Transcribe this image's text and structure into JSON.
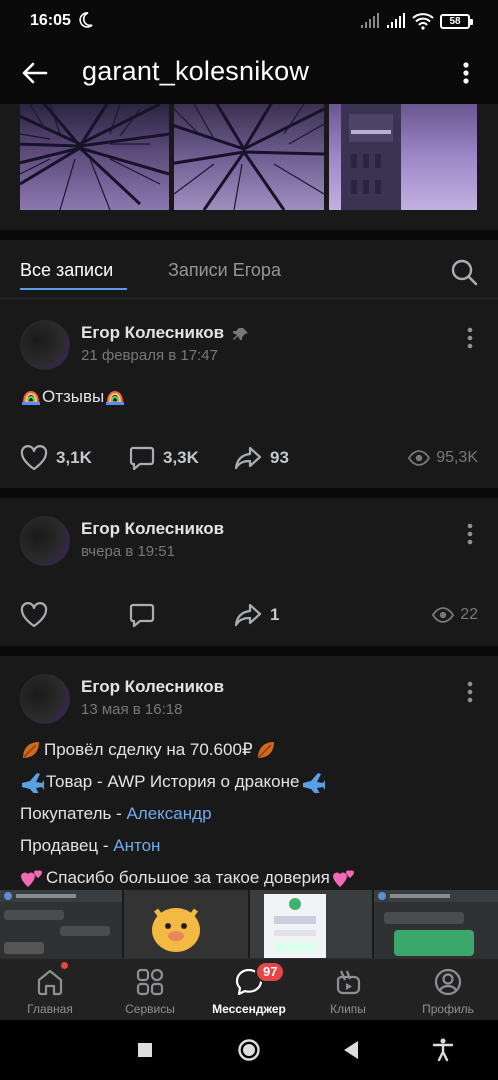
{
  "status_bar": {
    "time": "16:05",
    "battery": "58"
  },
  "header": {
    "title": "garant_kolesnikow"
  },
  "tabs": {
    "items": [
      {
        "label": "Все записи"
      },
      {
        "label": "Записи Егора"
      }
    ]
  },
  "posts": [
    {
      "author": "Егор Колесников",
      "date": "21 февраля в 17:47",
      "pinned": true,
      "text": "Отзывы",
      "likes": "3,1K",
      "comments": "3,3K",
      "shares": "93",
      "views": "95,3K"
    },
    {
      "author": "Егор Колесников",
      "date": "вчера в 19:51",
      "likes": "",
      "comments": "",
      "shares": "1",
      "views": "22"
    },
    {
      "author": "Егор Колесников",
      "date": "13 мая в 16:18",
      "lines": {
        "deal": "Провёл сделку на 70.600₽",
        "product": "Товар - AWP История о драконе",
        "buyer_label": "Покупатель - ",
        "buyer_name": "Александр",
        "seller_label": "Продавец - ",
        "seller_name": "Антон",
        "thanks": "Спасибо большое за такое доверия"
      }
    }
  ],
  "bottom_nav": {
    "items": [
      {
        "label": "Главная"
      },
      {
        "label": "Сервисы"
      },
      {
        "label": "Мессенджер"
      },
      {
        "label": "Клипы"
      },
      {
        "label": "Профиль"
      }
    ],
    "messenger_badge": "97"
  },
  "colors": {
    "accent": "#5c9ce6",
    "link": "#71aaeb",
    "badge": "#e64646"
  }
}
